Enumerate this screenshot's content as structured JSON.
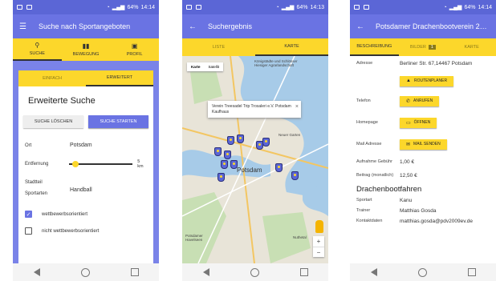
{
  "status": {
    "p1_time": "14:14",
    "p2_time": "14:13",
    "p3_time": "14:14",
    "battery": "64%"
  },
  "screen1": {
    "title": "Suche nach Sportangeboten",
    "tabs": [
      {
        "label": "SUCHE",
        "icon": "search-icon"
      },
      {
        "label": "BEWEGUNG",
        "icon": "chart-icon"
      },
      {
        "label": "PROFIL",
        "icon": "profile-card-icon"
      }
    ],
    "subtabs": [
      "EINFACH",
      "ERWEITERT"
    ],
    "heading": "Erweiterte Suche",
    "clear_button": "SUCHE LÖSCHEN",
    "start_button": "SUCHE STARTEN",
    "fields": {
      "ort_label": "Ort",
      "ort_value": "Potsdam",
      "entfernung_label": "Entfernung",
      "entfernung_value": "5 km",
      "entfernung_fraction": 0.05,
      "stadtteil_label": "Stadtteil",
      "sportarten_label": "Sportarten",
      "sportarten_value": "Handball"
    },
    "checkboxes": [
      {
        "label": "wettbewerbsorientiert",
        "checked": true
      },
      {
        "label": "nicht wettbewerbsorientiert",
        "checked": false
      }
    ]
  },
  "screen2": {
    "title": "Suchergebnis",
    "tabs": [
      "LISTE",
      "KARTE"
    ],
    "map_type": [
      "Karte",
      "Satellit"
    ],
    "popup_text": "Verein Treesadel Trip Trosaleri e.V. Potsdam Kaufhaus",
    "city_label": "Potsdam",
    "map_labels": [
      "Königstädte und Schlösser Hiesiger Agrarlandschaft",
      "Potsdamer Havelseen",
      "Nuthetal",
      "Neuer Garten"
    ],
    "zoom_in": "+",
    "zoom_out": "−"
  },
  "screen3": {
    "title": "Potsdamer Drachenbootverein 20...",
    "tabs": [
      "BESCHREIBUNG",
      "BILDER",
      "KARTE"
    ],
    "bilder_badge": "1",
    "rows": [
      {
        "label": "Adresse",
        "value": "Berliner Str. 67,14467 Potsdam"
      },
      {
        "label": "Telefon",
        "value": ""
      },
      {
        "label": "Homepage",
        "value": ""
      },
      {
        "label": "Mail Adresse",
        "value": ""
      },
      {
        "label": "Aufnahme Gebühr",
        "value": "1,00 €"
      },
      {
        "label": "Beitrag (monatlich)",
        "value": "12,50 €"
      }
    ],
    "buttons": {
      "route": "ROUTENPLANER",
      "call": "ANRUFEN",
      "open": "ÖFFNEN",
      "mail": "MAIL SENDEN"
    },
    "section_heading": "Drachenbootfahren",
    "sport_rows": [
      {
        "label": "Sportart",
        "value": "Kanu"
      },
      {
        "label": "Trainer",
        "value": "Matthias Gosda"
      },
      {
        "label": "Kontaktdaten",
        "value": "matthias.gosda@pdv2009ev.de"
      }
    ]
  }
}
